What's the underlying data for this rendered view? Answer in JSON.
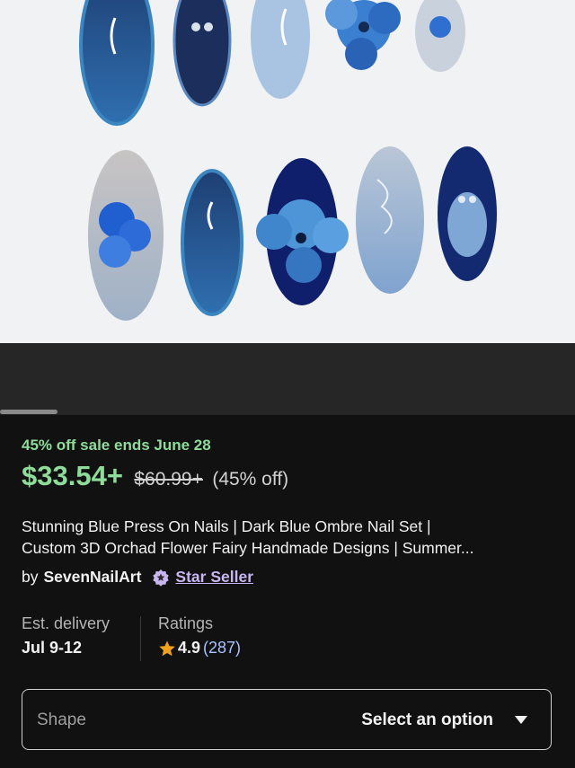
{
  "listing": {
    "sale_text": "45% off sale ends June 28",
    "price": "$33.54+",
    "original_price": "$60.99+",
    "discount": "(45% off)",
    "title_line1": "Stunning Blue Press On Nails | Dark Blue Ombre Nail Set |",
    "title_line2": "Custom 3D Orchad Flower Fairy Handmade Designs | Summer...",
    "seller_prefix": "by",
    "seller_name": "SevenNailArt",
    "star_seller_label": "Star Seller"
  },
  "details": {
    "delivery_label": "Est. delivery",
    "delivery_value": "Jul 9-12",
    "ratings_label": "Ratings",
    "rating_score": "4.9",
    "rating_count": "(287)"
  },
  "variation": {
    "label": "Shape",
    "placeholder": "Select an option"
  },
  "colors": {
    "sale_green": "#8fdb9a",
    "star_purple": "#c7b6ef",
    "link_blue": "#a9c2ff",
    "rating_star": "#f1a11a"
  },
  "icons": [
    "star-seller-badge-icon",
    "rating-star-icon",
    "caret-down-icon"
  ]
}
